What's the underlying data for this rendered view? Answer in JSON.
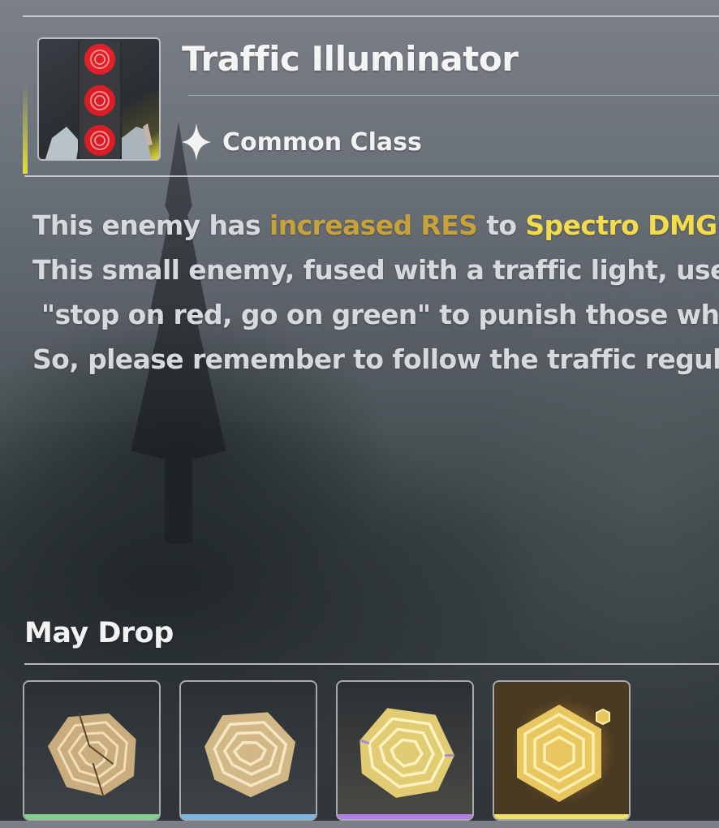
{
  "enemy": {
    "name": "Traffic Illuminator",
    "class_label": "Common Class",
    "class_icon": "four-point-star-icon",
    "portrait_icon": "traffic-light-enemy-portrait"
  },
  "description": {
    "line1_prefix": "This enemy has ",
    "line1_highlight_res": "increased RES",
    "line1_to": " to ",
    "line1_highlight_element": "Spectro DMG",
    "line1_end": ".",
    "line2": "This small enemy, fused with a traffic light, uses",
    "line3": " \"stop on red, go on green\" to punish those who",
    "line4": "So, please remember to follow the traffic regul"
  },
  "drops": {
    "title": "May Drop",
    "items": [
      {
        "icon": "cracked-ring-core-icon",
        "rarity_color": "#7fd38a"
      },
      {
        "icon": "ring-core-icon",
        "rarity_color": "#7ab8e6"
      },
      {
        "icon": "polished-ring-core-icon",
        "rarity_color": "#b57de8"
      },
      {
        "icon": "tidal-ring-core-icon",
        "rarity_color": "#efe06a"
      }
    ]
  },
  "colors": {
    "highlight_res": "#c7a23b",
    "highlight_element": "#f2dc4c",
    "divider": "#e1e4e8"
  }
}
